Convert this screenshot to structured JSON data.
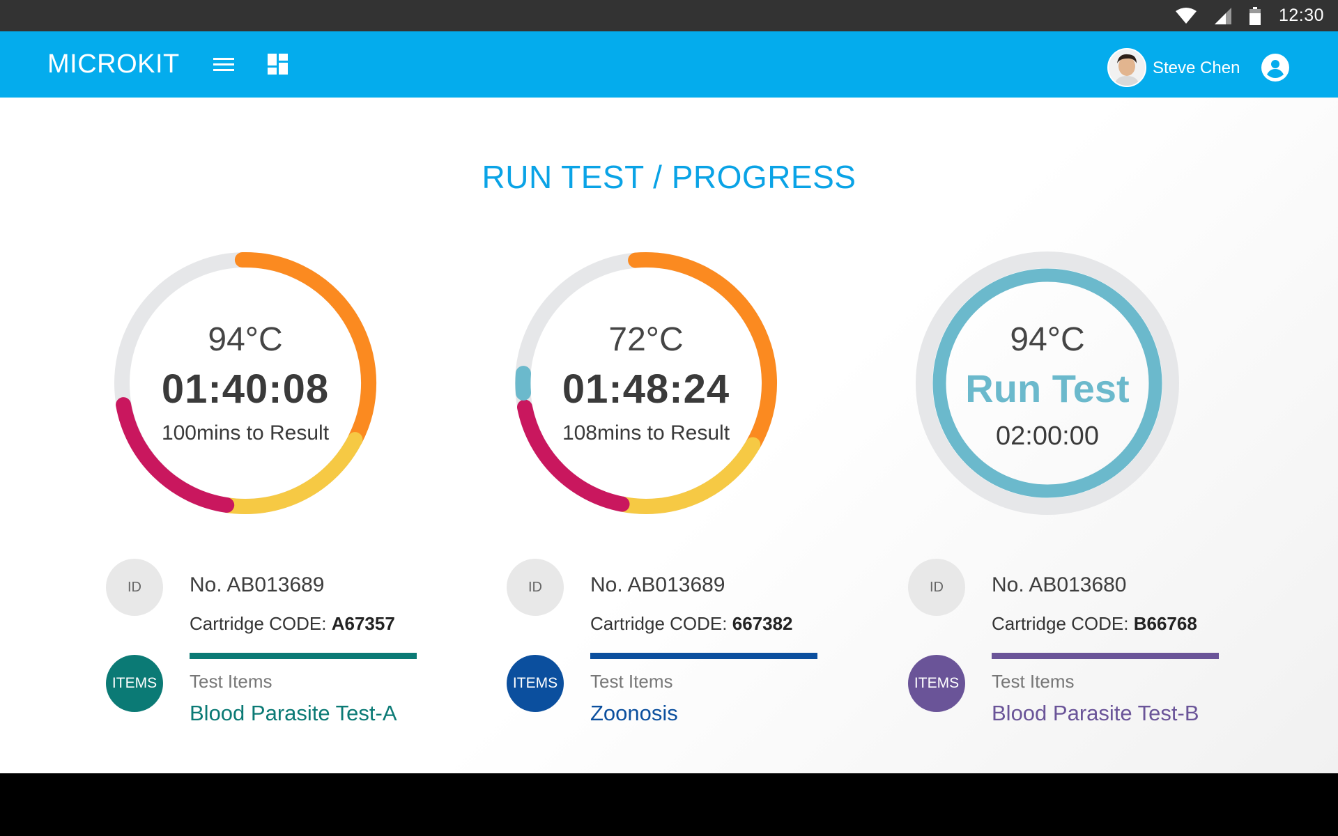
{
  "status_bar": {
    "time": "12:30"
  },
  "app_bar": {
    "title": "MICROKIT",
    "user_name": "Steve Chen"
  },
  "page": {
    "title": "RUN TEST / PROGRESS"
  },
  "cards": [
    {
      "temperature": "94°C",
      "time": "01:40:08",
      "result_text": "100mins to Result",
      "id_badge": "ID",
      "id_number": "No. AB013689",
      "cartridge_label": "Cartridge CODE: ",
      "cartridge_code": "A67357",
      "items_badge": "ITEMS",
      "test_items_label": "Test Items",
      "test_item": "Blood Parasite Test-A",
      "accent_color": "#0b7a75"
    },
    {
      "temperature": "72°C",
      "time": "01:48:24",
      "result_text": "108mins to Result",
      "id_badge": "ID",
      "id_number": "No. AB013689",
      "cartridge_label": "Cartridge CODE: ",
      "cartridge_code": "667382",
      "items_badge": "ITEMS",
      "test_items_label": "Test Items",
      "test_item": "Zoonosis",
      "accent_color": "#0b4f9e"
    },
    {
      "temperature": "94°C",
      "run_label": "Run Test",
      "time": "02:00:00",
      "id_badge": "ID",
      "id_number": "No. AB013680",
      "cartridge_label": "Cartridge CODE: ",
      "cartridge_code": "B66768",
      "items_badge": "ITEMS",
      "test_items_label": "Test Items",
      "test_item": "Blood Parasite Test-B",
      "accent_color": "#6a5498"
    }
  ],
  "colors": {
    "app_bar": "#04aced",
    "status_bar": "#333333",
    "title": "#0aa3e6",
    "ring_track": "#e6e7e9",
    "ring_orange": "#fb8a20",
    "ring_yellow": "#f6c944",
    "ring_magenta": "#c9175e",
    "ring_teal": "#6bb9cc"
  }
}
